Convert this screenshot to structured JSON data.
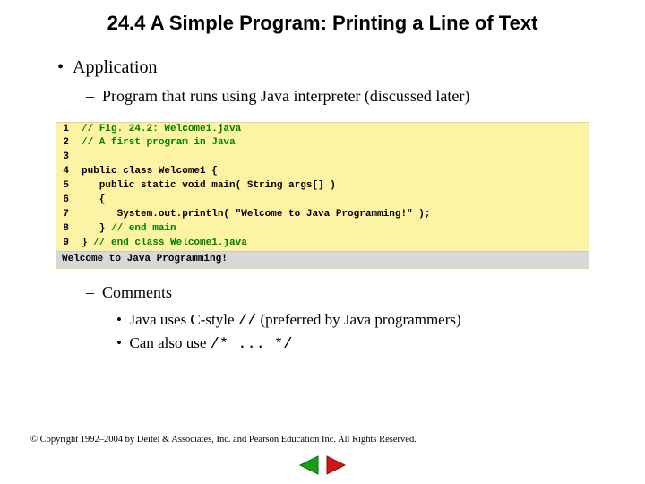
{
  "title": "24.4   A Simple Program: Printing a Line of Text",
  "bullets": {
    "application": "Application",
    "sub_desc": "Program that runs using Java interpreter (discussed later)",
    "comments_label": "Comments",
    "sub_sub_1_a": "Java uses C-style ",
    "sub_sub_1_mono": "//",
    "sub_sub_1_b": " (preferred by Java programmers)",
    "sub_sub_2_a": "Can also use ",
    "sub_sub_2_mono": "/*   ... */"
  },
  "code": {
    "lines": [
      {
        "no": "1",
        "comment": "// Fig. 24.2: Welcome1.java",
        "plain": ""
      },
      {
        "no": "2",
        "comment": "// A first program in Java",
        "plain": ""
      },
      {
        "no": "3",
        "comment": "",
        "plain": ""
      },
      {
        "no": "4",
        "comment": "",
        "plain": "public class Welcome1 {"
      },
      {
        "no": "5",
        "comment": "",
        "plain": "   public static void main( String args[] )"
      },
      {
        "no": "6",
        "comment": "",
        "plain": "   {"
      },
      {
        "no": "7",
        "comment": "",
        "plain": "      System.out.println( \"Welcome to Java Programming!\" );"
      },
      {
        "no": "8",
        "comment": "// end main",
        "plain": "   } "
      },
      {
        "no": "9",
        "comment": "// end class Welcome1.java",
        "plain": "} "
      }
    ],
    "output": "Welcome to Java Programming!"
  },
  "copyright": "© Copyright 1992–2004 by Deitel & Associates, Inc. and Pearson Education Inc. All Rights Reserved.",
  "nav": {
    "prev": "prev-slide",
    "next": "next-slide"
  }
}
